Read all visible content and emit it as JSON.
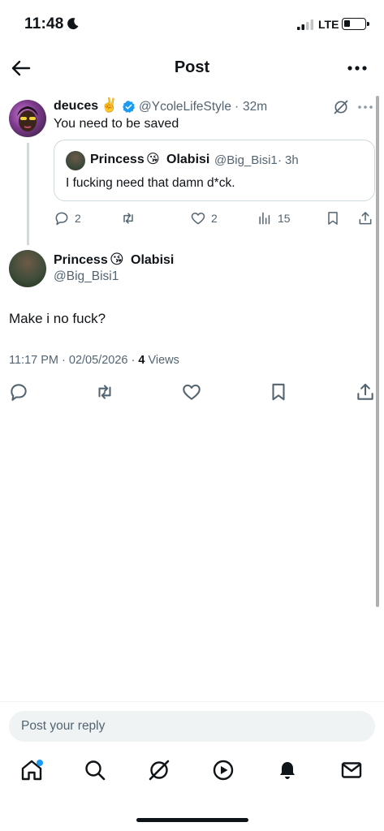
{
  "status_bar": {
    "time": "11:48",
    "network": "LTE"
  },
  "header": {
    "title": "Post"
  },
  "parent_post": {
    "author_name": "deuces",
    "author_emoji": "✌️",
    "author_handle": "@YcoleLifeStyle",
    "separator": "·",
    "time_ago": "32m",
    "text": "You need to be saved",
    "quoted": {
      "author_first": "Princess",
      "author_emoji": "😘",
      "author_last": "Olabisi",
      "author_handle": "@Big_Bisi1",
      "separator": "·",
      "time_ago": "3h",
      "text": "I fucking need that damn d*ck."
    },
    "actions": {
      "replies": "2",
      "likes": "2",
      "views": "15"
    }
  },
  "main_post": {
    "author_first": "Princess",
    "author_emoji": "😘",
    "author_last": "Olabisi",
    "author_handle": "@Big_Bisi1",
    "text": "Make i no fuck?",
    "timestamp": "11:17 PM · 02/05/2026 · ",
    "views_count": "4",
    "views_label": " Views"
  },
  "reply": {
    "placeholder": "Post your reply"
  },
  "colors": {
    "accent": "#1d9bf0",
    "secondary_text": "#536471",
    "border": "#cfd9de"
  }
}
